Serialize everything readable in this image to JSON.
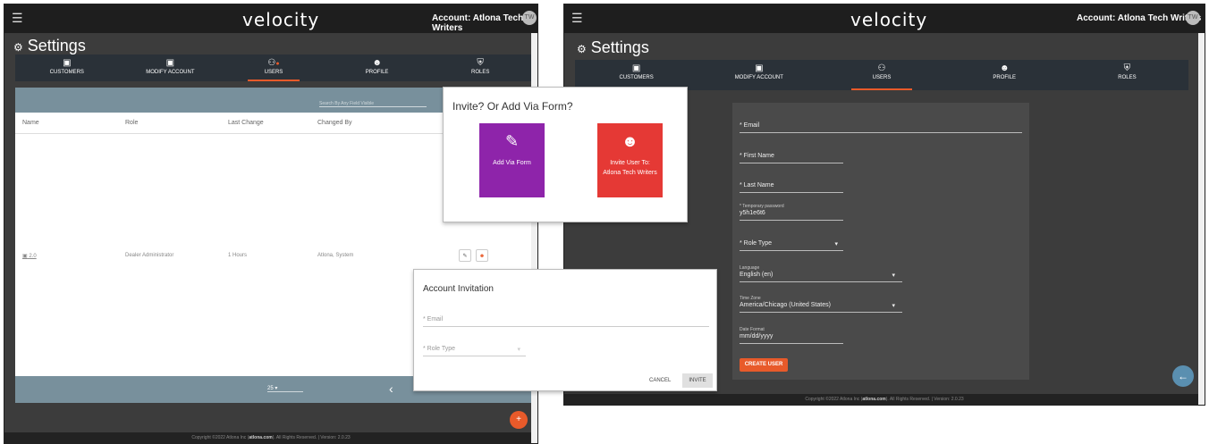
{
  "left_window": {
    "topbar": {
      "menu_icon": "hamburger-icon",
      "logo": "velocity",
      "account": "Account:  Atlona Tech Writers",
      "avatar": "TW"
    },
    "title": "Settings",
    "tabs": [
      {
        "label": "CUSTOMERS",
        "icon": "id-badge-icon"
      },
      {
        "label": "MODIFY ACCOUNT",
        "icon": "id-badge-icon"
      },
      {
        "label": "USERS",
        "icon": "users-icon",
        "active": true
      },
      {
        "label": "PROFILE",
        "icon": "person-icon"
      },
      {
        "label": "ROLES",
        "icon": "shield-icon"
      }
    ],
    "table": {
      "search_placeholder": "Search By Any Field Visible",
      "columns": [
        "Name",
        "Role",
        "Last Change",
        "Changed By"
      ],
      "rows": [
        {
          "name": "2.0",
          "role": "Dealer Administrator",
          "last_change": "1 Hours",
          "changed_by": "Atlona, System"
        }
      ],
      "page_size": "25"
    },
    "fab": "+",
    "footer": {
      "prefix": "Copyright ©2022 Atlona Inc (",
      "link": "atlona.com",
      "suffix": "). All Rights Reserved. | Version: 2.0.23"
    }
  },
  "invite_dialog": {
    "title": "Invite? Or Add Via Form?",
    "add_via_form": "Add Via Form",
    "invite_user_line1": "Invite User To:",
    "invite_user_line2": "Atlona Tech Writers",
    "colors": {
      "purple": "#8e24aa",
      "red": "#e53935"
    }
  },
  "account_invitation": {
    "title": "Account Invitation",
    "email_label": "* Email",
    "role_label": "* Role Type",
    "cancel": "CANCEL",
    "invite": "INVITE"
  },
  "right_window": {
    "topbar": {
      "menu_icon": "hamburger-icon",
      "logo": "velocity",
      "account": "Account:  Atlona Tech Writers",
      "avatar": "TW"
    },
    "title": "Settings",
    "tabs": [
      {
        "label": "CUSTOMERS",
        "icon": "id-badge-icon"
      },
      {
        "label": "MODIFY ACCOUNT",
        "icon": "id-badge-icon"
      },
      {
        "label": "USERS",
        "icon": "users-icon",
        "active": true
      },
      {
        "label": "PROFILE",
        "icon": "person-icon"
      },
      {
        "label": "ROLES",
        "icon": "shield-icon"
      }
    ],
    "form": {
      "email_label": "* Email",
      "first_name_label": "* First Name",
      "last_name_label": "* Last Name",
      "temp_password_label": "* Temporary password",
      "temp_password_value": "y5h1e6t6",
      "role_type_label": "* Role Type",
      "language_label": "Language",
      "language_value": "English (en)",
      "timezone_label": "Time Zone",
      "timezone_value": "America/Chicago (United States)",
      "date_format_label": "Date Format",
      "date_format_value": "mm/dd/yyyy",
      "create_button": "CREATE USER"
    },
    "back_icon": "arrow-left-icon",
    "footer": {
      "prefix": "Copyright ©2022 Atlona Inc (",
      "link": "atlona.com",
      "suffix": "). All Rights Reserved. | Version: 2.0.23"
    }
  }
}
